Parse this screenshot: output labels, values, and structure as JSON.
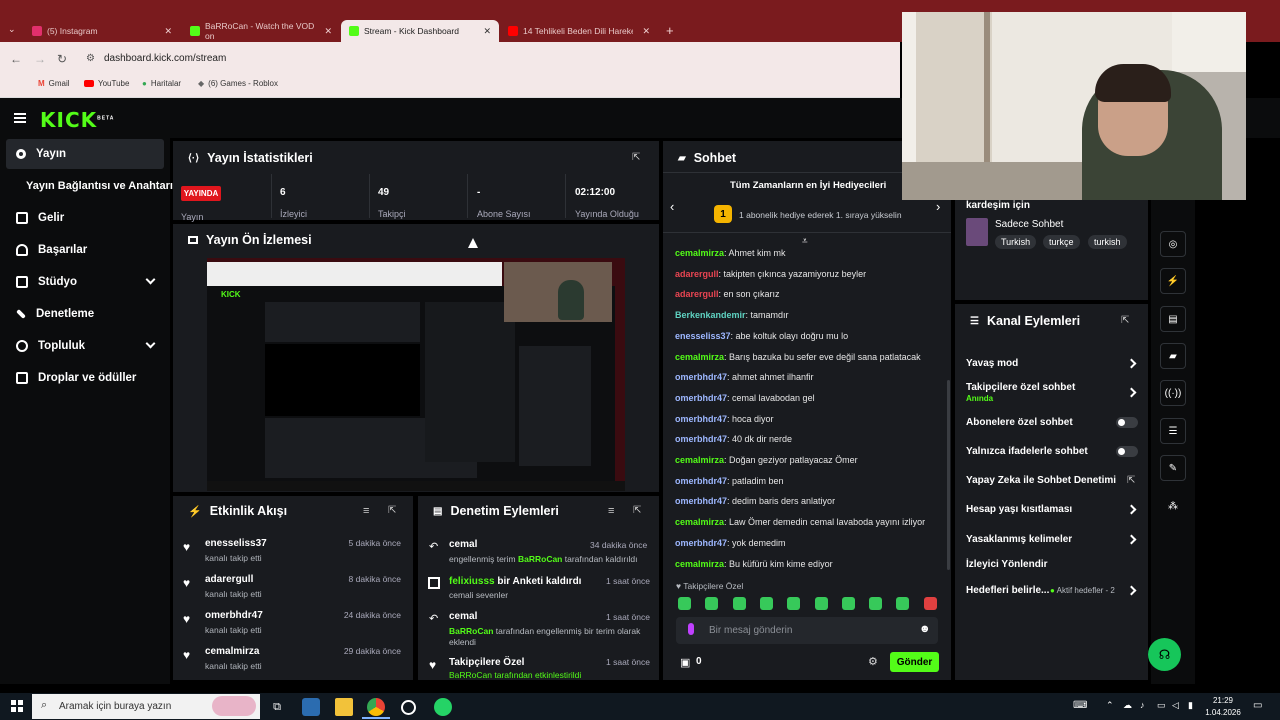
{
  "browser": {
    "tabs": [
      {
        "label": "(5) Instagram"
      },
      {
        "label": "BaRRoCan - Watch the VOD on"
      },
      {
        "label": "Stream - Kick Dashboard"
      },
      {
        "label": "14 Tehlikeli Beden Dili Hareketi"
      }
    ],
    "url": "dashboard.kick.com/stream",
    "bookmarks": [
      "Gmail",
      "YouTube",
      "Haritalar",
      "(6) Games - Roblox"
    ]
  },
  "kick": {
    "logo": "KICK",
    "beta": "BETA"
  },
  "sidebar": {
    "items": [
      {
        "label": "Yayın"
      },
      {
        "label": "Yayın Bağlantısı ve Anahtarı"
      },
      {
        "label": "Gelir"
      },
      {
        "label": "Başarılar"
      },
      {
        "label": "Stüdyo"
      },
      {
        "label": "Denetleme"
      },
      {
        "label": "Topluluk"
      },
      {
        "label": "Droplar ve ödüller"
      }
    ]
  },
  "stats": {
    "title": "Yayın İstatistikleri",
    "live_badge": "YAYINDA",
    "live_label": "Yayın",
    "items": [
      {
        "value": "6",
        "label": "İzleyici"
      },
      {
        "value": "49",
        "label": "Takipçi"
      },
      {
        "value": "-",
        "label": "Abone Sayısı"
      },
      {
        "value": "02:12:00",
        "label": "Yayında Olduğu"
      }
    ]
  },
  "preview": {
    "title": "Yayın Ön İzlemesi"
  },
  "activity": {
    "title": "Etkinlik Akışı",
    "events": [
      {
        "name": "enesseliss37",
        "sub": "kanalı takip etti",
        "time": "5 dakika önce"
      },
      {
        "name": "adarergull",
        "sub": "kanalı takip etti",
        "time": "8 dakika önce"
      },
      {
        "name": "omerbhdr47",
        "sub": "kanalı takip etti",
        "time": "24 dakika önce"
      },
      {
        "name": "cemalmirza",
        "sub": "kanalı takip etti",
        "time": "29 dakika önce"
      }
    ]
  },
  "moderation": {
    "title": "Denetim Eylemleri",
    "events": [
      {
        "name": "cemal",
        "line1a": "engellenmiş terim ",
        "user": "BaRRoCan",
        "line1b": " tarafından kaldırıldı",
        "time": "34 dakika önce"
      },
      {
        "name_user": "felixiusss",
        "name_rest": " bir Anketi kaldırdı",
        "sub": "cemali sevenler",
        "time": "1 saat önce"
      },
      {
        "name": "cemal",
        "user": "BaRRoCan",
        "line1b": " tarafından engellenmiş bir terim olarak",
        "line2": "eklendi",
        "time": "1 saat önce"
      },
      {
        "name": "Takipçilere Özel",
        "sub": "BaRRoCan tarafından etkinleştirildi",
        "time": "1 saat önce"
      }
    ]
  },
  "chat": {
    "title": "Sohbet",
    "leaderboard_title": "Tüm Zamanların en İyi Hediyecileri",
    "leaderboard_rank": "1",
    "leaderboard_text": "1 abonelik hediye ederek 1. sıraya yükselin",
    "messages": [
      {
        "user": "cemalmirza",
        "text": ": Ahmet kim mk",
        "color": "g"
      },
      {
        "user": "adarergull",
        "text": ": takipten çıkınca yazamiyoruz beyler",
        "color": "r"
      },
      {
        "user": "adarergull",
        "text": ": en son çıkarız",
        "color": "r"
      },
      {
        "user": "Berkenkandemir",
        "text": ": tamamdır",
        "color": "t"
      },
      {
        "user": "enesseliss37",
        "text": ": abe koltuk olayı doğru mu lo",
        "color": "b"
      },
      {
        "user": "cemalmirza",
        "text": ": Barış bazuka bu sefer eve değil sana patlatacak",
        "color": "g"
      },
      {
        "user": "omerbhdr47",
        "text": ": ahmet ahmet ilhanfir",
        "color": "b"
      },
      {
        "user": "omerbhdr47",
        "text": ": cemal lavabodan gel",
        "color": "b"
      },
      {
        "user": "omerbhdr47",
        "text": ": hoca diyor",
        "color": "b"
      },
      {
        "user": "omerbhdr47",
        "text": ": 40 dk dir nerde",
        "color": "b"
      },
      {
        "user": "cemalmirza",
        "text": ": Doğan geziyor patlayacaz Ömer",
        "color": "g"
      },
      {
        "user": "omerbhdr47",
        "text": ": patladim ben",
        "color": "b"
      },
      {
        "user": "omerbhdr47",
        "text": ": dedim baris ders anlatiyor",
        "color": "b"
      },
      {
        "user": "cemalmirza",
        "text": ": Law Ömer demedin cemal lavaboda yayını izliyor",
        "color": "g"
      },
      {
        "user": "omerbhdr47",
        "text": ": yok demedim",
        "color": "b"
      },
      {
        "user": "cemalmirza",
        "text": ": Bu küfürü kim kime ediyor",
        "color": "g"
      }
    ],
    "mode_label": "Takipçilere Özel",
    "input_placeholder": "Bir mesaj gönderin",
    "points": "0",
    "send_label": "Gönder"
  },
  "info": {
    "top_text": "kardeşim için",
    "category": "Sadece Sohbet",
    "tags": [
      "Turkish",
      "turkçe",
      "turkish"
    ]
  },
  "channel_actions": {
    "title": "Kanal Eylemleri",
    "items": [
      {
        "label": "Yavaş mod"
      },
      {
        "label": "Takipçilere özel sohbet",
        "sub": "Anında"
      },
      {
        "label": "Abonelere özel sohbet"
      },
      {
        "label": "Yalnızca ifadelerle sohbet"
      },
      {
        "label": "Yapay Zeka ile Sohbet Denetimi"
      },
      {
        "label": "Hesap yaşı kısıtlaması"
      },
      {
        "label": "Yasaklanmış kelimeler"
      },
      {
        "label": "İzleyici Yönlendir"
      },
      {
        "label": "Hedefleri belirle...",
        "sub": "Aktif hedefler - 2"
      }
    ]
  },
  "taskbar": {
    "search_placeholder": "Aramak için buraya yazın",
    "time": "21:29",
    "date": "1.04.2026"
  },
  "colors": {
    "kick_green": "#53fc18",
    "live_red": "#e0161d",
    "panel": "#191b1f"
  }
}
